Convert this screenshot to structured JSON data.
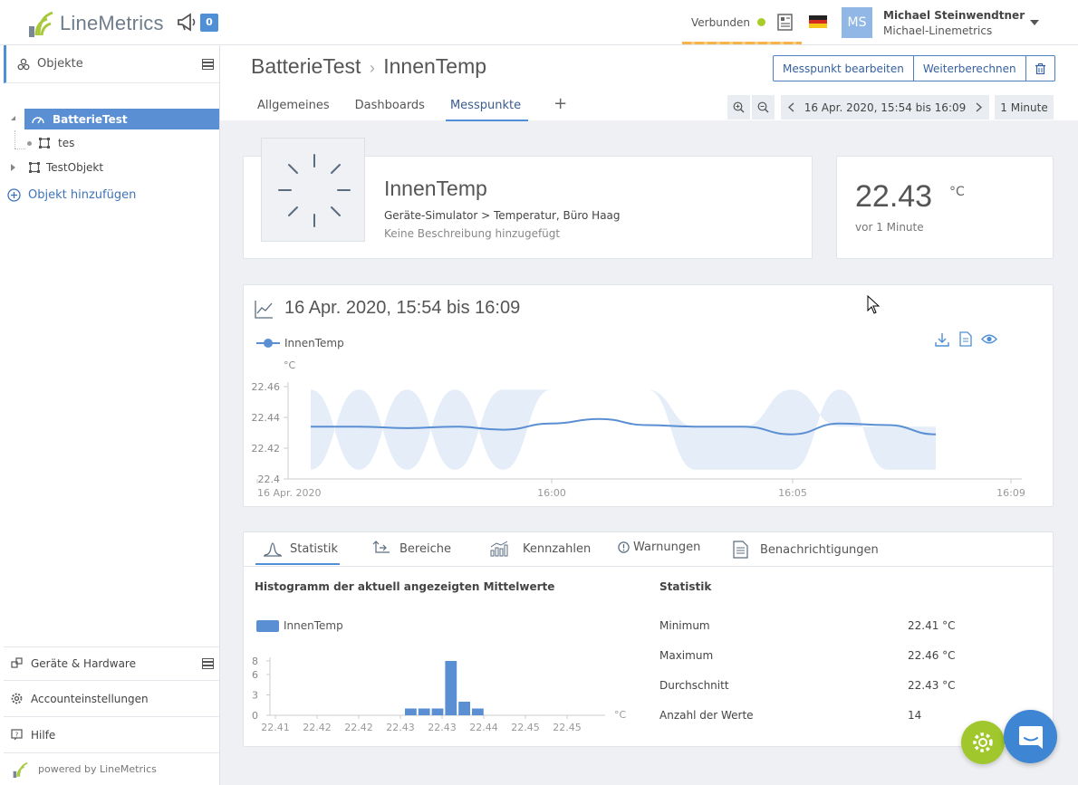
{
  "brand": {
    "name": "LineMetrics",
    "powered_by": "powered by LineMetrics"
  },
  "header": {
    "notification_count": "0",
    "connection_status": "Verbunden",
    "user": {
      "initials": "MS",
      "name": "Michael Steinwendtner",
      "account": "Michael-Linemetrics"
    }
  },
  "sidebar": {
    "title": "Objekte",
    "tree": [
      {
        "label": "BatterieTest",
        "selected": true
      },
      {
        "label": "tes"
      },
      {
        "label": "TestObjekt"
      }
    ],
    "add_object": "Objekt hinzufügen",
    "bottom": {
      "devices": "Geräte & Hardware",
      "account_settings": "Accounteinstellungen",
      "help": "Hilfe"
    }
  },
  "breadcrumb": {
    "parent": "BatterieTest",
    "separator": "›",
    "current": "InnenTemp"
  },
  "actions": {
    "edit": "Messpunkt bearbeiten",
    "recalc": "Weiterberechnen"
  },
  "tabs": [
    "Allgemeines",
    "Dashboards",
    "Messpunkte"
  ],
  "active_tab": "Messpunkte",
  "timebar": {
    "range": "16 Apr. 2020, 15:54 bis 16:09",
    "interval": "1 Minute"
  },
  "datapoint": {
    "name": "InnenTemp",
    "source": "Geräte-Simulator > Temperatur, Büro Haag",
    "description": "Keine Beschreibung hinzugefügt",
    "current_value": "22.43",
    "unit": "°C",
    "age": "vor 1 Minute"
  },
  "chart_title": "16 Apr. 2020, 15:54 bis 16:09",
  "chart_data": [
    {
      "type": "line",
      "series": [
        {
          "name": "InnenTemp",
          "x": [
            "15:55",
            "15:56",
            "15:57",
            "15:58",
            "15:59",
            "16:00",
            "16:01",
            "16:02",
            "16:03",
            "16:04",
            "16:05",
            "16:06",
            "16:07",
            "16:08"
          ],
          "values": [
            22.434,
            22.434,
            22.433,
            22.434,
            22.432,
            22.436,
            22.439,
            22.435,
            22.434,
            22.434,
            22.429,
            22.436,
            22.435,
            22.429
          ],
          "min": [
            22.406,
            22.458,
            22.406,
            22.458,
            22.406,
            22.458,
            22.458,
            22.458,
            22.406,
            22.406,
            22.406,
            22.458,
            22.406,
            22.406
          ],
          "max": [
            22.458,
            22.406,
            22.458,
            22.406,
            22.458,
            22.458,
            22.458,
            22.458,
            22.434,
            22.434,
            22.458,
            22.434,
            22.434,
            22.434
          ]
        }
      ],
      "xlabel": "",
      "ylabel": "°C",
      "ylim": [
        22.4,
        22.46
      ],
      "yticks": [
        "22.46",
        "22.44",
        "22.42",
        "22.4"
      ],
      "xticks": [
        "16 Apr. 2020",
        "16:00",
        "16:05",
        "16:09"
      ],
      "legend": "top-left",
      "grid": false
    },
    {
      "type": "bar",
      "title": "Histogramm der aktuell angezeigten Mittelwerte",
      "series": [
        {
          "name": "InnenTemp",
          "values": [
            0,
            0,
            0,
            0,
            0,
            0,
            0,
            0,
            0,
            0,
            1,
            1,
            1,
            8,
            2,
            1,
            0,
            0,
            0,
            0,
            0,
            0,
            0,
            0,
            0
          ]
        }
      ],
      "categories": [
        "22.41",
        "22.42",
        "22.42",
        "22.43",
        "22.43",
        "22.44",
        "22.45",
        "22.45"
      ],
      "xlabel": "°C",
      "ylim": [
        0,
        8
      ],
      "yticks": [
        "8",
        "6",
        "3",
        "0"
      ]
    }
  ],
  "stats_tabs": [
    "Statistik",
    "Bereiche",
    "Kennzahlen",
    "Warnungen",
    "Benachrichtigungen"
  ],
  "statistics": {
    "heading": "Statistik",
    "rows": [
      {
        "label": "Minimum",
        "value": "22.41 °C"
      },
      {
        "label": "Maximum",
        "value": "22.46 °C"
      },
      {
        "label": "Durchschnitt",
        "value": "22.43 °C"
      },
      {
        "label": "Anzahl der Werte",
        "value": "14"
      }
    ]
  },
  "colors": {
    "accent": "#4f8fd6",
    "series": "#5a8fd3",
    "band": "#e4edf8",
    "connected": "#a9cc28"
  }
}
